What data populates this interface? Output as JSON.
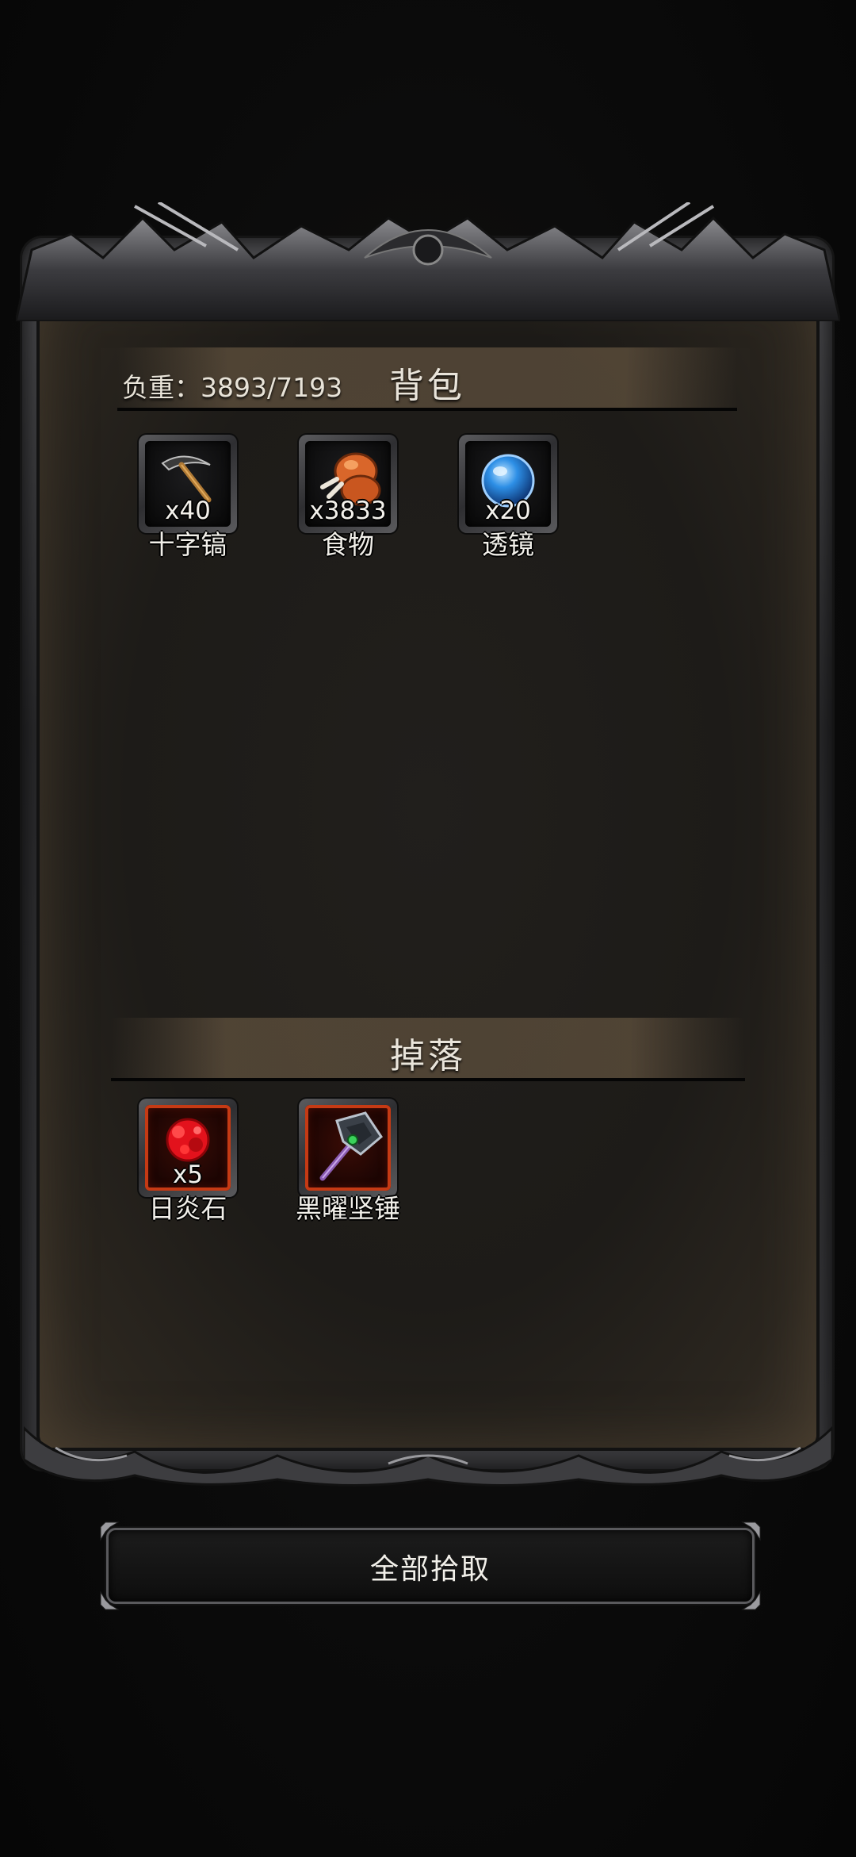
{
  "backpack": {
    "title": "背包",
    "weight_text": "负重：3893/7193",
    "items": [
      {
        "name": "十字镐",
        "qty": "x40",
        "icon": "pickaxe-icon"
      },
      {
        "name": "食物",
        "qty": "x3833",
        "icon": "drumstick-icon"
      },
      {
        "name": "透镜",
        "qty": "x20",
        "icon": "lens-orb-icon"
      }
    ]
  },
  "drops": {
    "title": "掉落",
    "items": [
      {
        "name": "日炎石",
        "qty": "x5",
        "icon": "sunflame-stone-icon",
        "rarity_color": "#c53a14"
      },
      {
        "name": "黑曜坚锤",
        "qty": "",
        "icon": "obsidian-hammer-icon",
        "rarity_color": "#c53a14"
      }
    ]
  },
  "actions": {
    "pickup_all_label": "全部拾取"
  }
}
